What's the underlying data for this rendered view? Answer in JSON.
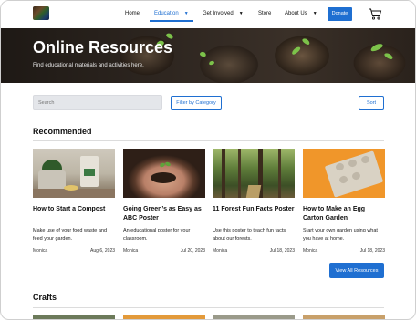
{
  "nav": {
    "items": [
      {
        "label": "Home",
        "caret": ""
      },
      {
        "label": "Education",
        "caret": "▼"
      },
      {
        "label": "Get Involved",
        "caret": "▼"
      },
      {
        "label": "Store",
        "caret": ""
      },
      {
        "label": "About Us",
        "caret": "▼"
      }
    ],
    "donate_label": "Donate"
  },
  "hero": {
    "title": "Online Resources",
    "subtitle": "Find educational materials and activities here."
  },
  "controls": {
    "search_placeholder": "Search",
    "filter_label": "Filter by Category",
    "sort_label": "Sort"
  },
  "recommended": {
    "title": "Recommended",
    "cards": [
      {
        "title": "How to Start a Compost",
        "desc": "Make use of your food waste and feed your garden.",
        "author": "Monica",
        "date": "Aug 6, 2023"
      },
      {
        "title": "Going Green’s as Easy as ABC Poster",
        "desc": "An educational poster for your classroom.",
        "author": "Monica",
        "date": "Jul 20, 2023"
      },
      {
        "title": "11 Forest Fun Facts Poster",
        "desc": "Use this poster to teach fun facts about our forests.",
        "author": "Monica",
        "date": "Jul 18, 2023"
      },
      {
        "title": "How to Make an Egg Carton Garden",
        "desc": "Start your own garden using what you have at home.",
        "author": "Monica",
        "date": "Jul 18, 2023"
      }
    ],
    "view_all_label": "View All Resources"
  },
  "crafts": {
    "title": "Crafts"
  },
  "colors": {
    "accent": "#1f6fd1"
  }
}
